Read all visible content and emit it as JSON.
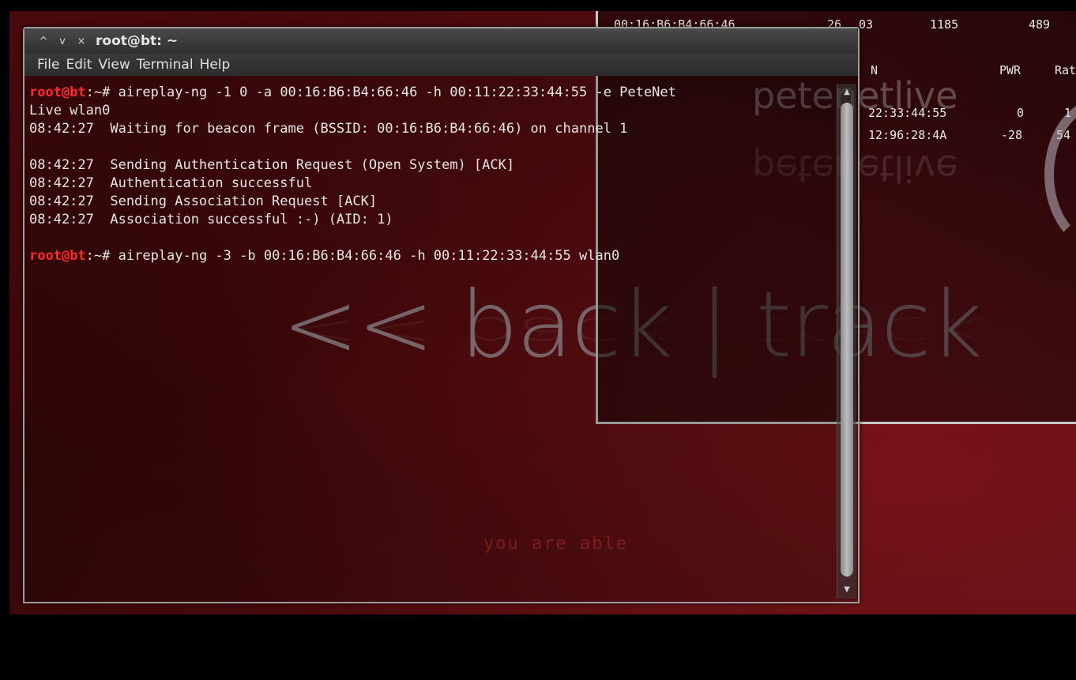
{
  "window": {
    "title": "root@bt: ~",
    "titlebar_buttons": [
      "^",
      "v",
      "×"
    ],
    "menu": [
      "File",
      "Edit",
      "View",
      "Terminal",
      "Help"
    ]
  },
  "terminal_lines": [
    {
      "prompt": true,
      "user": "root",
      "host": "@bt",
      "path": ":~",
      "symbol": "#",
      "text": " aireplay-ng -1 0 -a 00:16:B6:B4:66:46 -h 00:11:22:33:44:55 -e PeteNet"
    },
    {
      "prompt": false,
      "text": "Live wlan0"
    },
    {
      "prompt": false,
      "text": "08:42:27  Waiting for beacon frame (BSSID: 00:16:B6:B4:66:46) on channel 1"
    },
    {
      "prompt": false,
      "text": ""
    },
    {
      "prompt": false,
      "text": "08:42:27  Sending Authentication Request (Open System) [ACK]"
    },
    {
      "prompt": false,
      "text": "08:42:27  Authentication successful"
    },
    {
      "prompt": false,
      "text": "08:42:27  Sending Association Request [ACK]"
    },
    {
      "prompt": false,
      "text": "08:42:27  Association successful :-) (AID: 1)"
    },
    {
      "prompt": false,
      "text": ""
    },
    {
      "prompt": true,
      "user": "root",
      "host": "@bt",
      "path": ":~",
      "symbol": "#",
      "text": " aireplay-ng -3 -b 00:16:B6:B4:66:46 -h 00:11:22:33:44:55 wlan0"
    }
  ],
  "background_terminal": {
    "row1": {
      "bssid": "00:16:B6:B4:66:46",
      "c1": "26",
      "c2": "03",
      "c3": "1185",
      "c4": "489"
    },
    "header": {
      "station": "N",
      "pwr": "PWR",
      "rate": "Rat"
    },
    "row2": {
      "station": "22:33:44:55",
      "pwr": "0",
      "rate": "1"
    },
    "row3": {
      "station": "12:96:28:4A",
      "pwr": "-28",
      "rate": "54"
    }
  },
  "wallpaper": {
    "logo": "<< back | track",
    "brand": "petenetlive",
    "slogan": "you are able"
  }
}
